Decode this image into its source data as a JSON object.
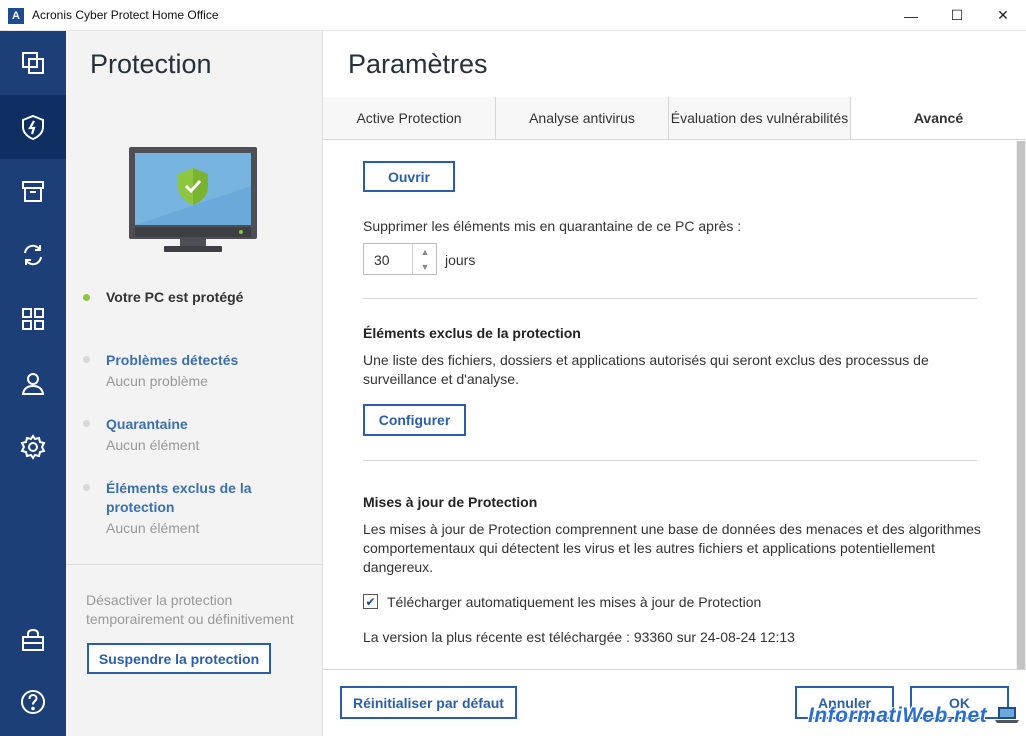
{
  "window": {
    "title": "Acronis Cyber Protect Home Office",
    "logo_letter": "A",
    "minimize": "—",
    "maximize": "☐",
    "close": "✕"
  },
  "rail": {
    "items": [
      {
        "icon": "copies-icon"
      },
      {
        "icon": "shield-lightning-icon",
        "active": true
      },
      {
        "icon": "archive-icon"
      },
      {
        "icon": "sync-icon"
      },
      {
        "icon": "dashboard-grid-icon"
      },
      {
        "icon": "account-icon"
      },
      {
        "icon": "settings-gear-icon"
      },
      {
        "icon": "shop-icon"
      },
      {
        "icon": "help-icon"
      }
    ]
  },
  "side": {
    "title": "Protection",
    "status": "Votre PC est protégé",
    "status_color": "#8dc63f",
    "links": [
      {
        "label": "Problèmes détectés",
        "sub": "Aucun problème"
      },
      {
        "label": "Quarantaine",
        "sub": "Aucun élément"
      },
      {
        "label": "Éléments exclus de la protection",
        "sub": "Aucun élément"
      }
    ],
    "note": "Désactiver la protection temporairement ou définitivement",
    "suspend_button": "Suspendre la protection"
  },
  "main": {
    "title": "Paramètres",
    "tabs": [
      {
        "label": "Active Protection"
      },
      {
        "label": "Analyse antivirus"
      },
      {
        "label": "Évaluation des vulnérabilités"
      },
      {
        "label": "Avancé",
        "active": true
      }
    ],
    "open_button": "Ouvrir",
    "quarantine_delete_label": "Supprimer les éléments mis en quarantaine de ce PC après :",
    "quarantine_days_value": "30",
    "quarantine_days_unit": "jours",
    "exclusions": {
      "heading": "Éléments exclus de la protection",
      "description": "Une liste des fichiers, dossiers et applications autorisés qui seront exclus des processus de surveillance et d'analyse.",
      "button": "Configurer"
    },
    "updates": {
      "heading": "Mises à jour de Protection",
      "description": "Les mises à jour de Protection comprennent une base de données des menaces et des algorithmes comportementaux qui détectent les virus et les autres fichiers et applications potentiellement dangereux.",
      "auto_download_label": "Télécharger automatiquement les mises à jour de Protection",
      "auto_download_checked": true,
      "latest_version": "La version la plus récente est téléchargée : 93360 sur 24-08-24 12:13"
    }
  },
  "footer": {
    "reset_button": "Réinitialiser par défaut",
    "cancel_button": "Annuler",
    "ok_button": "OK"
  },
  "watermark": {
    "text": "InformatiWeb.net"
  },
  "colors": {
    "rail": "#1c3f78",
    "rail_active": "#0f2e61",
    "accent": "#2a5fa7",
    "link": "#3a6fb0"
  }
}
